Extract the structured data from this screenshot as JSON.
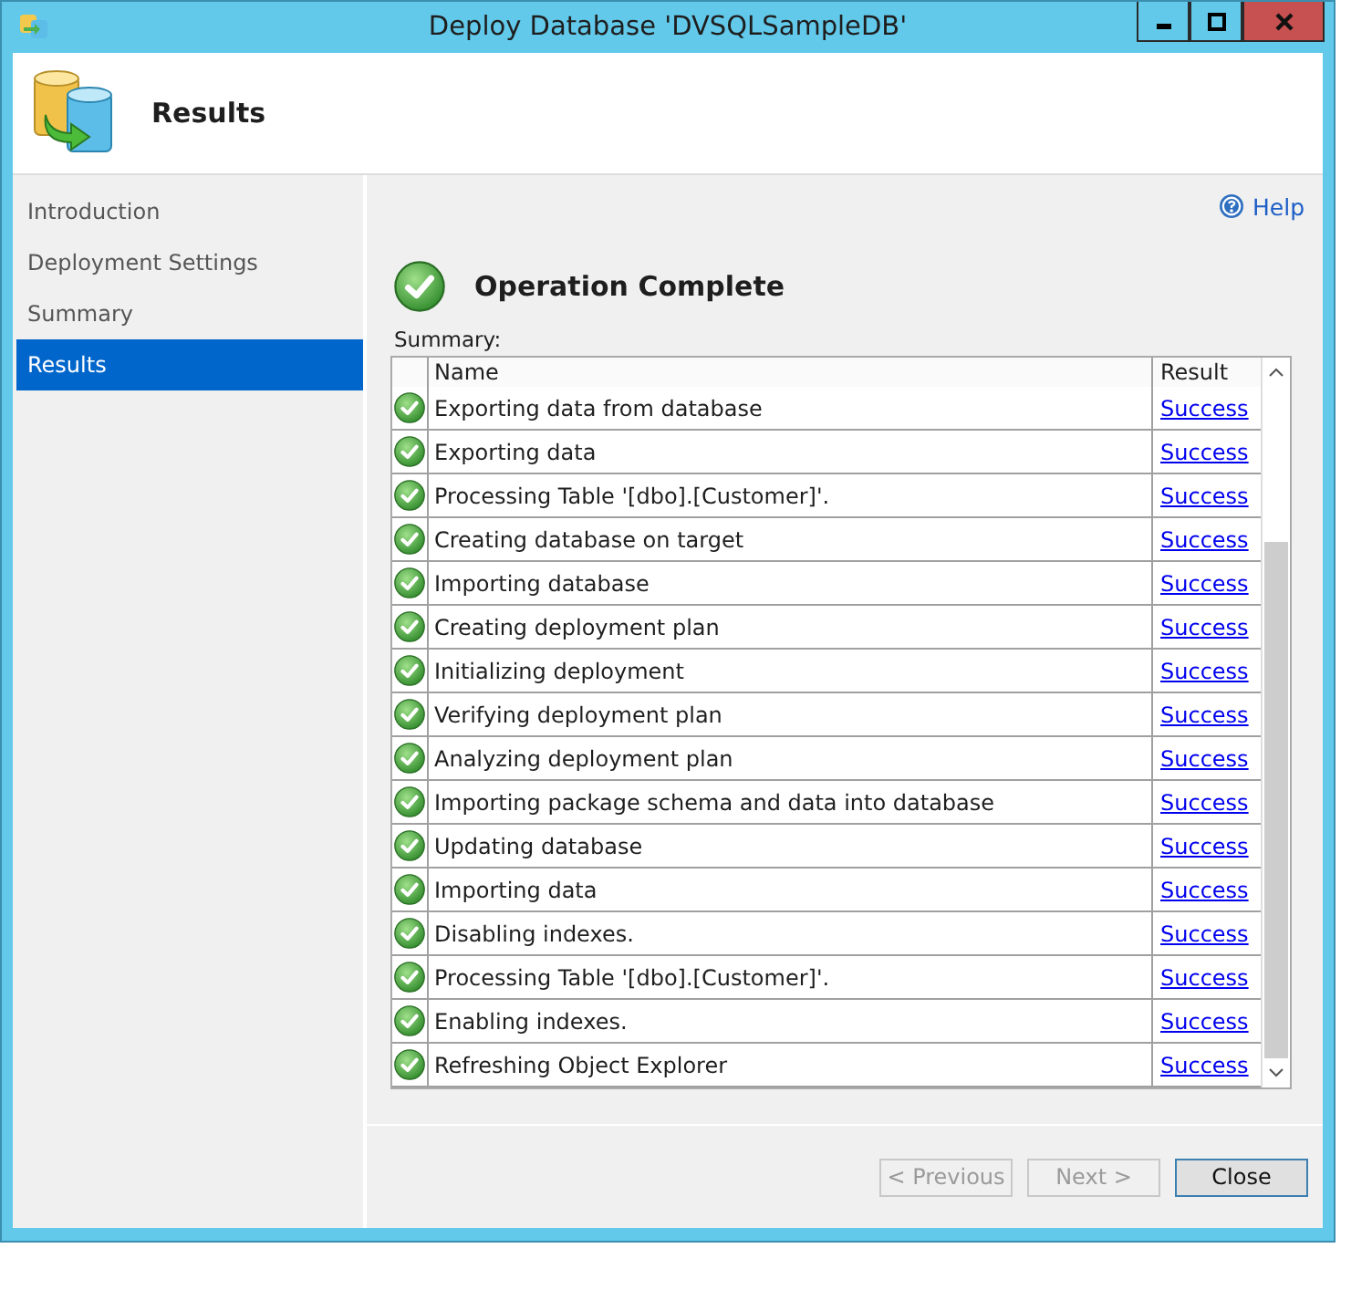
{
  "window": {
    "title": "Deploy Database 'DVSQLSampleDB'"
  },
  "header": {
    "title": "Results"
  },
  "sidebar": {
    "items": [
      {
        "label": "Introduction",
        "selected": false
      },
      {
        "label": "Deployment Settings",
        "selected": false
      },
      {
        "label": "Summary",
        "selected": false
      },
      {
        "label": "Results",
        "selected": true
      }
    ]
  },
  "help": {
    "label": "Help"
  },
  "status": {
    "title": "Operation Complete"
  },
  "summary_label": "Summary:",
  "table": {
    "columns": [
      "Name",
      "Result"
    ],
    "rows": [
      {
        "name": "Exporting data from database",
        "result": "Success"
      },
      {
        "name": "Exporting data",
        "result": "Success"
      },
      {
        "name": "Processing Table '[dbo].[Customer]'.",
        "result": "Success"
      },
      {
        "name": "Creating database on target",
        "result": "Success"
      },
      {
        "name": "Importing database",
        "result": "Success"
      },
      {
        "name": "Creating deployment plan",
        "result": "Success"
      },
      {
        "name": "Initializing deployment",
        "result": "Success"
      },
      {
        "name": "Verifying deployment plan",
        "result": "Success"
      },
      {
        "name": "Analyzing deployment plan",
        "result": "Success"
      },
      {
        "name": "Importing package schema and data into database",
        "result": "Success"
      },
      {
        "name": "Updating database",
        "result": "Success"
      },
      {
        "name": "Importing data",
        "result": "Success"
      },
      {
        "name": "Disabling indexes.",
        "result": "Success"
      },
      {
        "name": "Processing Table '[dbo].[Customer]'.",
        "result": "Success"
      },
      {
        "name": "Enabling indexes.",
        "result": "Success"
      },
      {
        "name": "Refreshing Object Explorer",
        "result": "Success"
      }
    ]
  },
  "buttons": [
    {
      "label": "< Previous",
      "disabled": true
    },
    {
      "label": "Next >",
      "disabled": true
    },
    {
      "label": "Close",
      "disabled": false
    }
  ]
}
